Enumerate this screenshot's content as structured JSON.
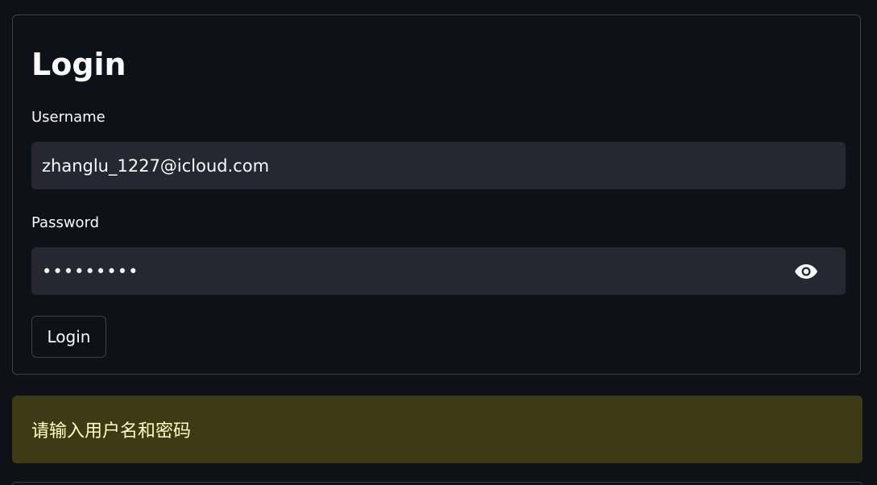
{
  "form": {
    "title": "Login",
    "username_label": "Username",
    "username_value": "zhanglu_1227@icloud.com",
    "password_label": "Password",
    "password_masked": "•••••••••",
    "submit_label": "Login"
  },
  "alert": {
    "message": "请输入用户名和密码",
    "type": "warning"
  },
  "icons": {
    "password_toggle": "eye-icon"
  },
  "colors": {
    "background": "#0e1117",
    "input_background": "#262730",
    "border": "#3d4049",
    "warning_background": "#3e3a16",
    "warning_text": "#ffffc2",
    "text": "#fafafa"
  }
}
